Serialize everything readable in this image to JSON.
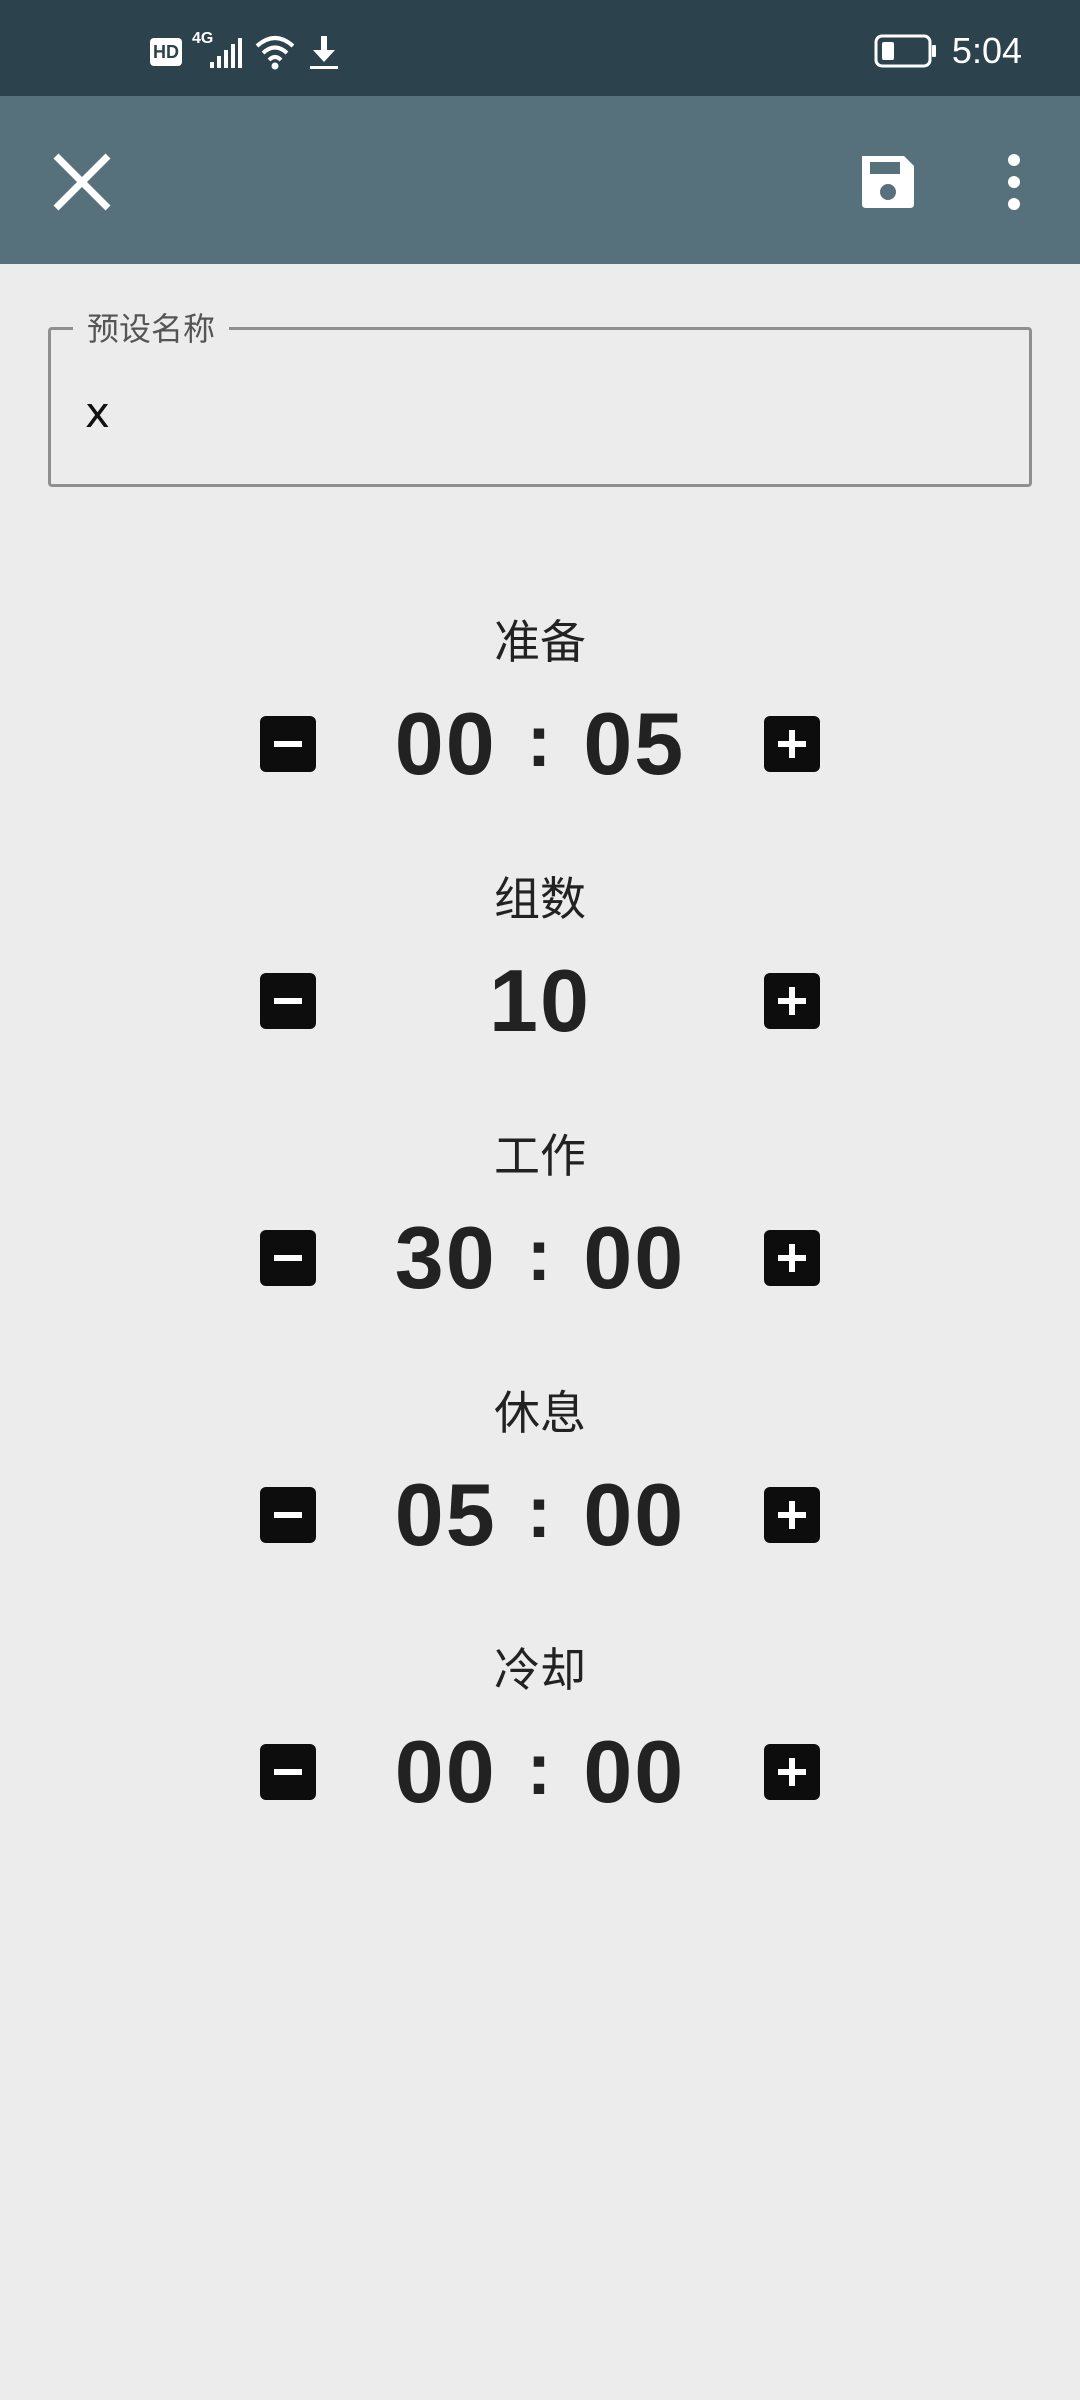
{
  "status_bar": {
    "time": "5:04",
    "hd_label": "HD",
    "network_label": "4G",
    "icons": [
      "hd-icon",
      "signal-icon",
      "wifi-icon",
      "download-icon",
      "battery-icon"
    ]
  },
  "toolbar": {
    "close_icon": "close-icon",
    "save_icon": "save-icon",
    "more_icon": "more-vert-icon",
    "background": "#56717b"
  },
  "preset": {
    "label": "预设名称",
    "value": "x"
  },
  "sections": {
    "prepare": {
      "label": "准备",
      "minutes": "00",
      "seconds": "05"
    },
    "sets": {
      "label": "组数",
      "value": "10"
    },
    "work": {
      "label": "工作",
      "minutes": "30",
      "seconds": "00"
    },
    "rest": {
      "label": "休息",
      "minutes": "05",
      "seconds": "00"
    },
    "cooldown": {
      "label": "冷却",
      "minutes": "00",
      "seconds": "00"
    }
  },
  "colon": ":",
  "colors": {
    "status_bar": "#2c424c",
    "toolbar": "#56717b",
    "background": "#ececec",
    "stepper": "#0d0d0d"
  }
}
